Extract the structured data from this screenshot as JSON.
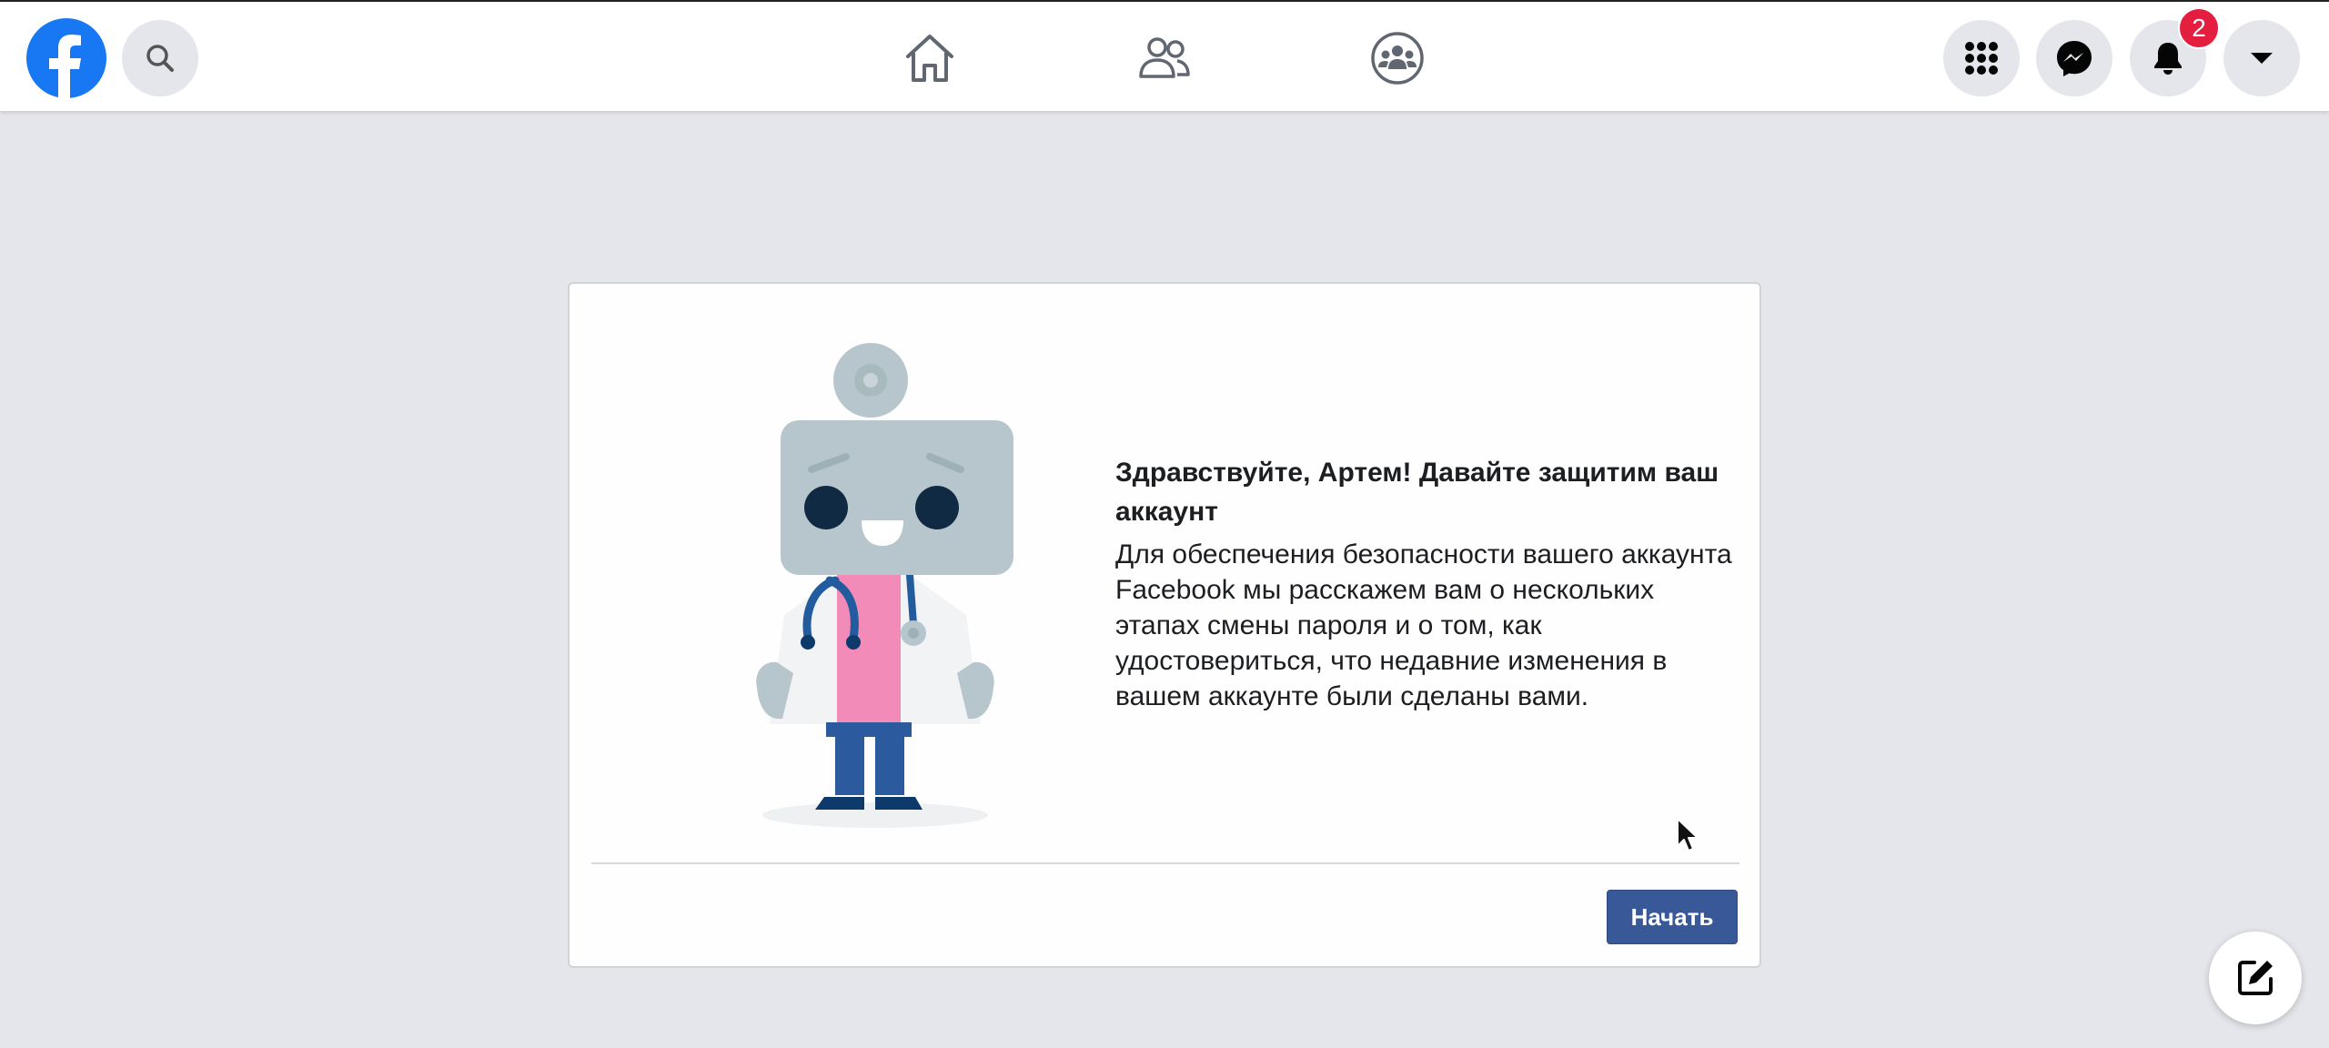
{
  "header": {
    "logo_icon": "facebook-logo-icon",
    "search_icon": "search-icon",
    "nav": [
      {
        "name": "home",
        "icon": "home-icon"
      },
      {
        "name": "friends",
        "icon": "friends-icon"
      },
      {
        "name": "groups",
        "icon": "groups-icon"
      }
    ],
    "actions": [
      {
        "name": "menu",
        "icon": "grid-menu-icon"
      },
      {
        "name": "messenger",
        "icon": "messenger-icon"
      },
      {
        "name": "notifications",
        "icon": "bell-icon",
        "badge": "2"
      },
      {
        "name": "account",
        "icon": "caret-down-icon"
      }
    ]
  },
  "card": {
    "illustration_icon": "robot-doctor-icon",
    "title": "Здравствуйте, Артем! Давайте защитим ваш аккаунт",
    "body": "Для обеспечения безопасности вашего аккаунта Facebook мы расскажем вам о нескольких этапах смены пароля и о том, как удостовериться, что недавние изменения в вашем аккаунте были сделаны вами.",
    "start_button": "Начать"
  },
  "compose_icon": "compose-icon",
  "colors": {
    "brand_blue": "#1877f2",
    "button_blue": "#385898",
    "badge_red": "#e41e3f",
    "page_background": "#e4e6eb"
  }
}
